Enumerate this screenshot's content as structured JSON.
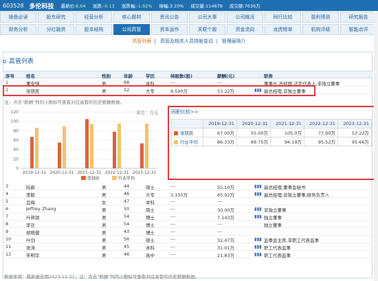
{
  "header": {
    "code": "603528",
    "name": "多伦科技",
    "stats": [
      {
        "label": "最新价:",
        "value": "6.64"
      },
      {
        "label": "涨跌:",
        "value": "-0.13"
      },
      {
        "label": "涨跌幅:",
        "value": "-1.92%"
      },
      {
        "label": "振幅:",
        "value": "3.10%"
      },
      {
        "label": "成交量:",
        "value": "114679"
      },
      {
        "label": "成交额:",
        "value": "7636万"
      }
    ]
  },
  "nav1": [
    "操盘必读",
    "股东研究",
    "经营分析",
    "核心题材",
    "资讯公告",
    "公司大事",
    "公司概况",
    "同行比较",
    "盈利预测",
    "研究报告"
  ],
  "nav2": [
    "财务分析",
    "分红融资",
    "股本结构",
    "公司高管",
    "资本运作",
    "关联个股",
    "资金流向",
    "龙虎榜单",
    "机构评级",
    "智能点评"
  ],
  "nav2_active": "公司高管",
  "subnav": {
    "items": [
      "高管列表",
      "高管及相关人员持股变动",
      "管理层简介"
    ],
    "sep": "|"
  },
  "section_title": "高管列表",
  "table_header": [
    "序号",
    "姓名",
    "性别",
    "年龄",
    "学历",
    "持股数(股)",
    "薪酬(元)",
    "",
    "职务"
  ],
  "rows_top": [
    [
      "1",
      "董安强",
      "男",
      "68",
      "本科",
      "---",
      "---",
      "",
      "董事长,总经理,法定代表人,非独立董事"
    ],
    [
      "2",
      "张铁民",
      "男",
      "52",
      "大专",
      "9,500万",
      "53.22万",
      "▮▮▮",
      "副总经理,非独立董事"
    ]
  ],
  "note": "注：点击\"薪酬\"列的小图标可查看对应高管的历史薪酬数据。",
  "unit_label": "单位：万元",
  "comparison": {
    "title": "同职比较>>",
    "years": [
      "2019-12-31",
      "2020-12-31",
      "2021-12-31",
      "2022-12-31",
      "2023-12-31"
    ],
    "rows": [
      {
        "name": "张铁民",
        "values": [
          "67.00万",
          "55.00万",
          "105.0万",
          "77.90万",
          "53.22万"
        ]
      },
      {
        "name": "行业平均",
        "values": [
          "86.33万",
          "89.75万",
          "94.19万",
          "95.52万",
          "95.66万"
        ]
      }
    ]
  },
  "chart_data": {
    "type": "bar",
    "categories": [
      "2019-12-31",
      "2020-12-31",
      "2021-12-31",
      "2022-12-31",
      "2023-12-31"
    ],
    "series": [
      {
        "name": "张铁民",
        "values": [
          67.0,
          55.0,
          105.0,
          77.9,
          53.22
        ],
        "color": "#d9633a"
      },
      {
        "name": "行业平均",
        "values": [
          86.33,
          89.75,
          94.19,
          95.52,
          95.66
        ],
        "color": "#f2c36b"
      }
    ],
    "yticks": [
      0,
      20,
      40,
      60,
      80,
      100,
      120
    ],
    "ylim": [
      0,
      120
    ],
    "grid": true,
    "legend": "bottom"
  },
  "rows_bottom": [
    [
      "3",
      "阮蔚",
      "男",
      "44",
      "硕士",
      "---",
      "55.10万",
      "▮▮▮",
      "副总经理,董事会秘书"
    ],
    [
      "4",
      "李毅",
      "男",
      "46",
      "大专",
      "3,150万",
      "65.02万",
      "▮▮▮",
      "副总经理,非独立董事,财务负责人"
    ],
    [
      "5",
      "吕梅",
      "女",
      "47",
      "本科",
      "---",
      "---",
      "",
      ""
    ],
    [
      "6",
      "Jeffrey Zhang",
      "男",
      "50",
      "硕士",
      "---",
      "30.00万",
      "▮▮▮",
      "非独立董事"
    ],
    [
      "7",
      "叶邦银",
      "男",
      "54",
      "博士",
      "---",
      "7.143万",
      "▮▮▮",
      "独立董事"
    ],
    [
      "8",
      "李迁",
      "男",
      "54",
      "博士",
      "---",
      "---",
      "",
      "独立董事"
    ],
    [
      "9",
      "胡晓健",
      "男",
      "43",
      "博士",
      "---",
      "---",
      "",
      ""
    ],
    [
      "10",
      "叶剑",
      "男",
      "56",
      "硕士",
      "---",
      "32.47万",
      "▮▮▮",
      "监事会主席,非职工代表监事"
    ],
    [
      "11",
      "张涛",
      "男",
      "45",
      "本科",
      "---",
      "31.01万",
      "▮▮▮",
      "职工代表监事"
    ],
    [
      "12",
      "朱明华",
      "男",
      "46",
      "高中",
      "---",
      "21.83万",
      "▮▮▮",
      "职工代表监事"
    ]
  ],
  "footer": "数据来源：最新报告期2023-12-31；注：点击\"薪酬\"列的小图标可查看对应高管的历史薪酬数据。",
  "colors": {
    "accent": "#1f6fb2",
    "highlight": "#d33333"
  }
}
